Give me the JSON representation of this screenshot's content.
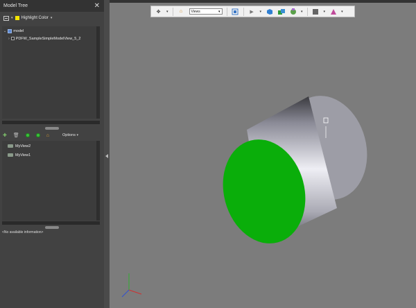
{
  "panel": {
    "title": "Model Tree",
    "close_glyph": "✕",
    "highlight_label": "Highlight Color",
    "dropdown_glyph": "▾"
  },
  "tree": {
    "items": [
      {
        "label": "model"
      },
      {
        "label": "PDFW_SampleSimpleModelView_5_2"
      }
    ]
  },
  "views": {
    "options_label": "Options",
    "items": [
      {
        "label": "MyView2"
      },
      {
        "label": "MyView1"
      }
    ]
  },
  "info": {
    "text": "<No available information>"
  },
  "toolbar": {
    "views_select_value": "Views",
    "glyphs": {
      "home": "⌂",
      "play": "▶"
    }
  },
  "colors": {
    "face": "#0aae0a",
    "highlight": "#f3e400"
  }
}
